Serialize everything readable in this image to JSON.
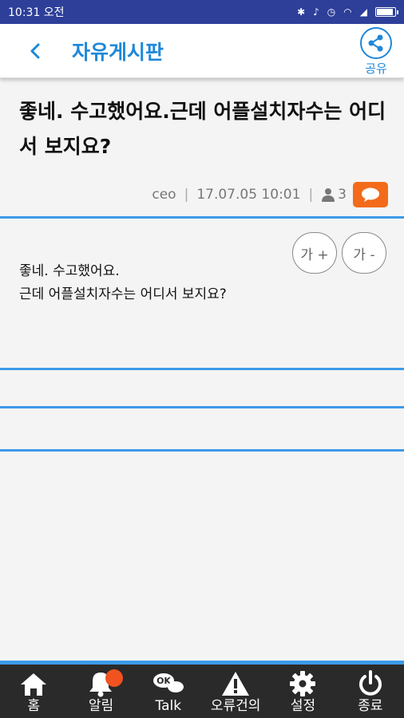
{
  "status": {
    "time": "10:31 오전"
  },
  "appbar": {
    "title": "자유게시판",
    "share_label": "공유"
  },
  "post": {
    "title": "좋네. 수고했어요.근데 어플설치자수는 어디서 보지요?",
    "author": "ceo",
    "datetime": "17.07.05 10:01",
    "views": "3",
    "body_line1": "좋네. 수고했어요.",
    "body_line2": "근데 어플설치자수는 어디서 보지요?"
  },
  "zoom": {
    "increase_label": "가 +",
    "decrease_label": "가 -"
  },
  "tabs": [
    {
      "label": "홈",
      "icon": "home-icon"
    },
    {
      "label": "알림",
      "icon": "bell-icon"
    },
    {
      "label": "Talk",
      "icon": "talk-icon"
    },
    {
      "label": "오류건의",
      "icon": "warning-icon"
    },
    {
      "label": "설정",
      "icon": "gear-icon"
    },
    {
      "label": "종료",
      "icon": "power-icon"
    }
  ],
  "colors": {
    "accent": "#1e88d8",
    "statusbar": "#2d3f99",
    "orange": "#f36b1a",
    "tabbar": "#2a2a2a"
  }
}
